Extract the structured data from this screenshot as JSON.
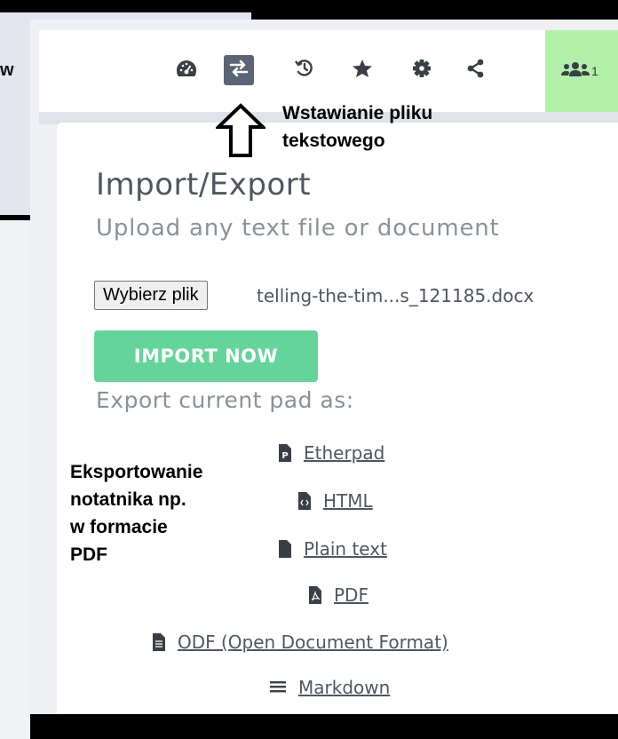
{
  "background": {
    "partial_label": "w"
  },
  "toolbar": {
    "icons": [
      "dashboard-icon",
      "import-export-icon",
      "history-icon",
      "star-icon",
      "settings-icon",
      "share-icon"
    ],
    "users_count": "1"
  },
  "annotations": {
    "import_label_line1": "Wstawianie pliku",
    "import_label_line2": "tekstowego",
    "export_label_line1": "Eksportowanie",
    "export_label_line2": "notatnika np.",
    "export_label_line3": "w formacie",
    "export_label_line4": "PDF"
  },
  "popup": {
    "title": "Import/Export",
    "subtitle": "Upload any text file or document",
    "file_button": "Wybierz plik",
    "file_name": "telling-the-tim...s_121185.docx",
    "import_button": "IMPORT NOW",
    "export_heading": "Export current pad as:",
    "exports": [
      {
        "label": "Etherpad",
        "icon": "etherpad-file-icon"
      },
      {
        "label": "HTML",
        "icon": "html-file-icon"
      },
      {
        "label": "Plain text",
        "icon": "text-file-icon"
      },
      {
        "label": "PDF",
        "icon": "pdf-file-icon"
      },
      {
        "label": "ODF (Open Document Format)",
        "icon": "odf-file-icon"
      },
      {
        "label": "Markdown",
        "icon": "markdown-icon"
      }
    ]
  },
  "colors": {
    "accent_green": "#64d49b",
    "active_button": "#5b6474",
    "users_bg": "#b3f0a7"
  }
}
